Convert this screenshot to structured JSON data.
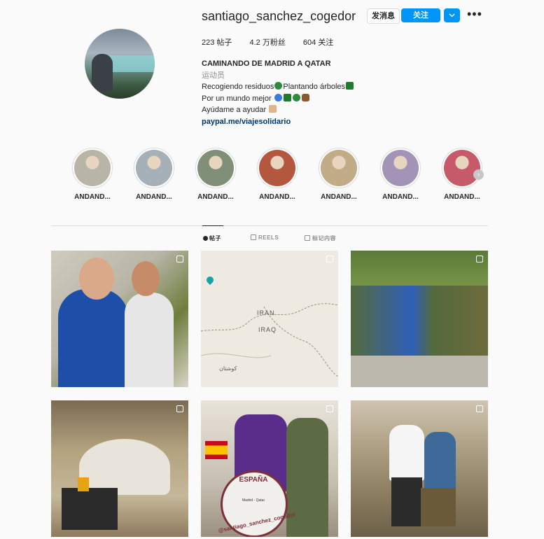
{
  "profile": {
    "username": "santiago_sanchez_cogedor",
    "message_button": "发消息",
    "follow_button": "关注",
    "dropdown_icon": "chevron-down-icon",
    "more_icon": "more-options-icon",
    "stats": {
      "posts": "223 帖子",
      "followers": "4.2 万粉丝",
      "following": "604 关注"
    },
    "bio": {
      "name": "CAMINANDO DE MADRID A QATAR",
      "category": "运动员",
      "line1_a": "Recogiendo residuos",
      "line1_b": "Plantando árboles",
      "line2": "Por un mundo mejor",
      "line3": "Ayúdame a ayudar",
      "link": "paypal.me/viajesolidario"
    }
  },
  "highlights": [
    {
      "label": "ANDAND...",
      "color": "#b9b4a8"
    },
    {
      "label": "ANDAND...",
      "color": "#a6b0b8"
    },
    {
      "label": "ANDAND...",
      "color": "#7f8f78"
    },
    {
      "label": "ANDAND...",
      "color": "#b3573e"
    },
    {
      "label": "ANDAND...",
      "color": "#c2ac88"
    },
    {
      "label": "ANDAND...",
      "color": "#a394b7"
    },
    {
      "label": "ANDAND...",
      "color": "#c65a6a"
    }
  ],
  "tabs": [
    {
      "label": "帖子",
      "icon": "grid-icon",
      "active": true
    },
    {
      "label": "REELS",
      "icon": "reels-icon",
      "active": false
    },
    {
      "label": "标记内容",
      "icon": "tagged-icon",
      "active": false
    }
  ],
  "posts": [
    {
      "alt": "man with child"
    },
    {
      "alt": "map"
    },
    {
      "alt": "group with soldiers"
    },
    {
      "alt": "tent"
    },
    {
      "alt": "walking with cart"
    },
    {
      "alt": "two men"
    }
  ],
  "map": {
    "iran": "IRAN",
    "iraq": "IRAQ",
    "city": "کوشتان"
  },
  "cart_sign": {
    "country": "ESPAÑA",
    "handle": "@santiago_sanchez_cogedor",
    "inner": "Madrid - Qatar"
  },
  "colors": {
    "accent": "#0095f6",
    "link": "#00376b"
  }
}
